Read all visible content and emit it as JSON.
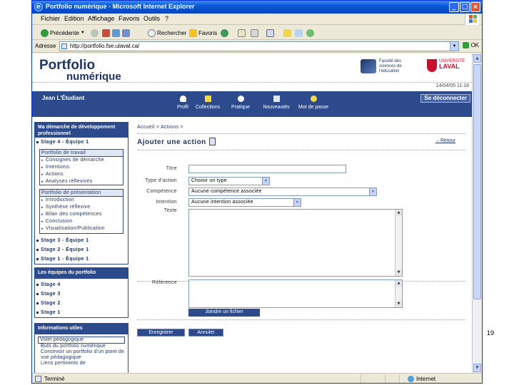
{
  "window": {
    "title": "Portfolio numérique - Microsoft Internet Explorer",
    "minimize_glyph": "_",
    "maximize_glyph": "□",
    "close_glyph": "×"
  },
  "menubar": [
    "Fichier",
    "Edition",
    "Affichage",
    "Favoris",
    "Outils",
    "?"
  ],
  "toolbar": {
    "back_label": "Précédente",
    "search_label": "Rechercher",
    "favorites_label": "Favoris"
  },
  "address_bar": {
    "label": "Adresse",
    "url": "http://portfolio.fse.ulaval.ca/",
    "go_label": "OK"
  },
  "header": {
    "logo_line1": "Portfolio",
    "logo_line2": "numérique",
    "faculty_lines": "Faculté des sciences de l'éducation",
    "university_top": "UNIVERSITÉ",
    "university_name": "LAVAL",
    "date": "14/04/05 11:18"
  },
  "nav": {
    "user": "Jean L'Étudiant",
    "logout_label": "Se déconnecter",
    "items": [
      "Profil",
      "Collections",
      "Pratique",
      "Nouveautés",
      "Mot de passe"
    ]
  },
  "sidebar": {
    "demarche_title": "Ma démarche de développement professionnel",
    "stage4": "Stage 4 - Équipe 1",
    "travail_header": "Portfolio de travail",
    "travail_items": [
      "Consignes de démarche",
      "Intentions",
      "Actions",
      "Analyses réflexives"
    ],
    "presentation_header": "Portfolio de présentation",
    "presentation_items": [
      "Introduction",
      "Synthèse réflexive",
      "Bilan des compétences",
      "Conclusion",
      "Visualisation/Publication"
    ],
    "stages_below": [
      "Stage 3 - Équipe 1",
      "Stage 2 - Équipe 1",
      "Stage 1 - Équipe 1"
    ],
    "equipes_title": "Les équipes du portfolio",
    "equipes_items": [
      "Stage 4",
      "Stage 3",
      "Stage 2",
      "Stage 1"
    ],
    "infos_title": "Informations utiles",
    "infos_items": [
      "Volet pédagogique",
      "Buts du portfolio numérique",
      "Concevoir un portfolio d'un point de vue pédagogique",
      "Liens pertinents de"
    ]
  },
  "form": {
    "breadcrumb": "Accueil > Actions >",
    "title": "Ajouter une action",
    "back_link": "Retour",
    "labels": {
      "titre": "Titre",
      "type": "Type d'action",
      "competence": "Compétence",
      "intention": "Intention",
      "texte": "Texte",
      "reference": "Référence"
    },
    "type_value": "Choisir un type",
    "competence_value": "Aucune compétence associée",
    "intention_value": "Aucune intention associée",
    "attach_button": "Joindre un fichier",
    "save_button": "Enregistrer",
    "cancel_button": "Annuler"
  },
  "statusbar": {
    "left": "Terminé",
    "zone": "Internet"
  },
  "slide_number": "19"
}
